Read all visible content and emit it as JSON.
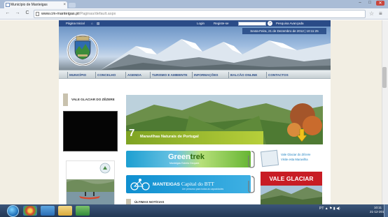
{
  "browser": {
    "tab_title": "Município de Manteigas",
    "tab_close": "×",
    "url_domain": "www.cm-manteigas.pt",
    "url_path": "/Paginas/default.aspx",
    "back": "←",
    "forward": "→",
    "reload": "C",
    "bookmark_star": "☆",
    "menu_icon": "≡",
    "minimize": "–",
    "maximize": "□",
    "close": "✕"
  },
  "site": {
    "topbar": {
      "home": "Página Inicial",
      "login": "Login",
      "register": "Registe-se",
      "advanced_search": "Pesquisa Avançada",
      "search_go": "»"
    },
    "date_line": "Sexta-Feira, 21 de Dezembro de 2012 | 10:11:25",
    "nav": [
      "MUNICÍPIO",
      "CONCELHO",
      "AGENDA",
      "TURISMO E AMBIENTE",
      "INFORMAÇÕES",
      "BALCÃO ONLINE",
      "CONTACTOS"
    ],
    "left": {
      "glacier_title": "VALE GLACIAR DO ZÊZERE"
    },
    "feature": {
      "number": "7",
      "text": "Maravilhas Naturais de Portugal"
    },
    "greentrek": {
      "title_a": "Green",
      "title_b": "trek",
      "subtitle": "Manteigas Estrela Geopark"
    },
    "glacier_link": {
      "line1": "Vale Glaciar do Zêzere",
      "line2": "Visite esta Maravilha"
    },
    "btt": {
      "title": "MANTEIGAS",
      "capital": "Capital do BTT",
      "subtitle": "Um percurso para todas as capacidades"
    },
    "vale_banner": "VALE GLACIAR",
    "news_title": "ÚLTIMAS NOTÍCIAS"
  },
  "taskbar": {
    "tray_lang": "PT",
    "clock_time": "10:11",
    "clock_date": "21-12-2012"
  },
  "colors": {
    "site_blue": "#2a4b87",
    "nav_gray": "#c6cfd3",
    "green_band": "#7ea323",
    "vale_red": "#c81c24"
  }
}
